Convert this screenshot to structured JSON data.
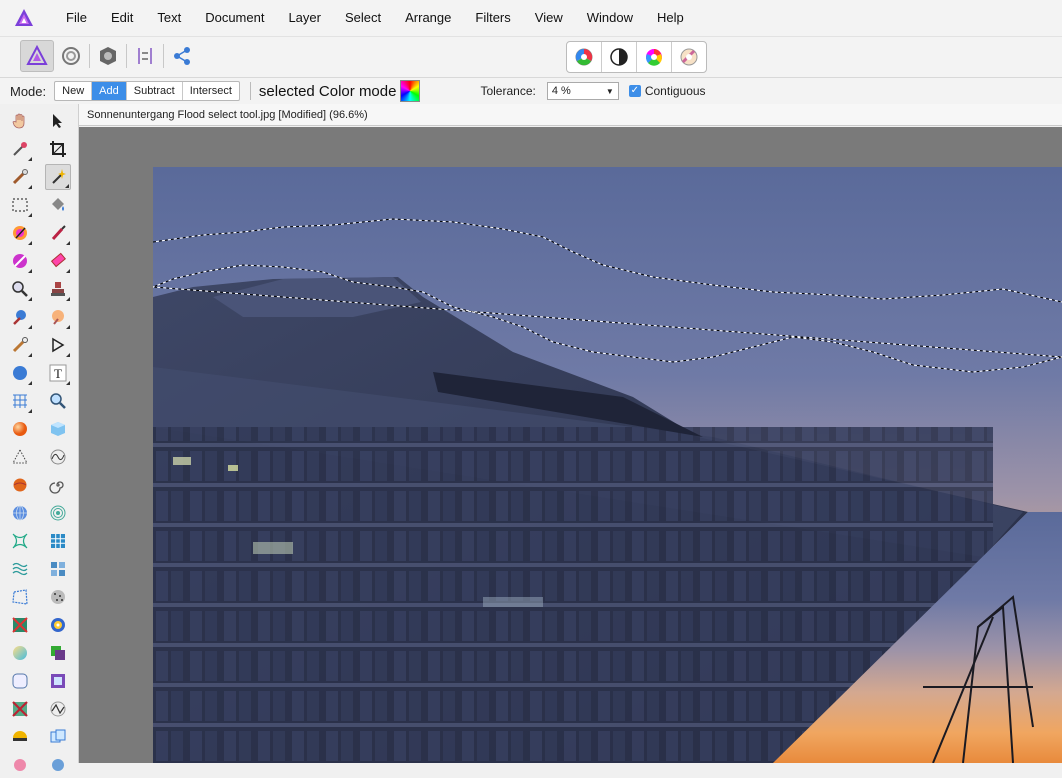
{
  "menu": [
    "File",
    "Edit",
    "Text",
    "Document",
    "Layer",
    "Select",
    "Arrange",
    "Filters",
    "View",
    "Window",
    "Help"
  ],
  "toolbar": {
    "personas": [
      "photo-persona-icon",
      "liquify-persona-icon",
      "develop-persona-icon",
      "tone-mapping-persona-icon",
      "export-persona-icon"
    ],
    "adjust": [
      "auto-levels-icon",
      "auto-contrast-icon",
      "auto-colors-icon",
      "auto-white-balance-icon"
    ]
  },
  "context": {
    "mode_label": "Mode:",
    "modes": [
      "New",
      "Add",
      "Subtract",
      "Intersect"
    ],
    "active_mode": "Add",
    "selected_mode_text": "selected Color mode",
    "tolerance_label": "Tolerance:",
    "tolerance_value": "4 %",
    "contiguous_label": "Contiguous",
    "contiguous_checked": true
  },
  "document": {
    "tab_title": "Sonnenuntergang Flood select tool.jpg [Modified] (96.6%)"
  },
  "colors": {
    "accent": "#3d8ee8",
    "canvas": "#7a7a7a"
  }
}
